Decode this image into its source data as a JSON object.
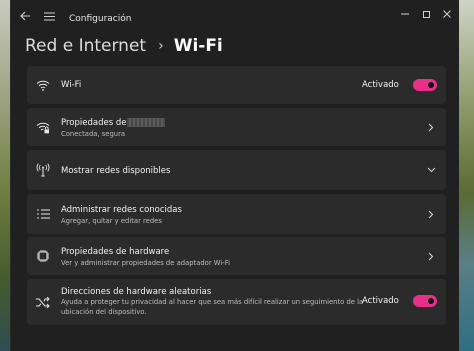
{
  "window": {
    "app_title": "Configuración"
  },
  "breadcrumb": {
    "parent": "Red e Internet",
    "separator": "›",
    "current": "Wi-Fi"
  },
  "rows": [
    {
      "title": "Wi-Fi",
      "state": "Activado",
      "toggle_on": true
    },
    {
      "title": "Propiedades de",
      "subtitle": "Conectada, segura"
    },
    {
      "title": "Mostrar redes disponibles"
    },
    {
      "title": "Administrar redes conocidas",
      "subtitle": "Agregar, quitar y editar redes"
    },
    {
      "title": "Propiedades de hardware",
      "subtitle": "Ver y administrar propiedades de adaptador Wi-Fi"
    },
    {
      "title": "Direcciones de hardware aleatorias",
      "subtitle_line1": "Ayuda a proteger tu privacidad al hacer que sea más difícil realizar un seguimiento de la",
      "subtitle_line2": "ubicación del dispositivo.",
      "state": "Activado",
      "toggle_on": true
    }
  ],
  "colors": {
    "accent": "#e8308a",
    "window_bg": "#202020",
    "card_bg": "#2b2b2b"
  }
}
